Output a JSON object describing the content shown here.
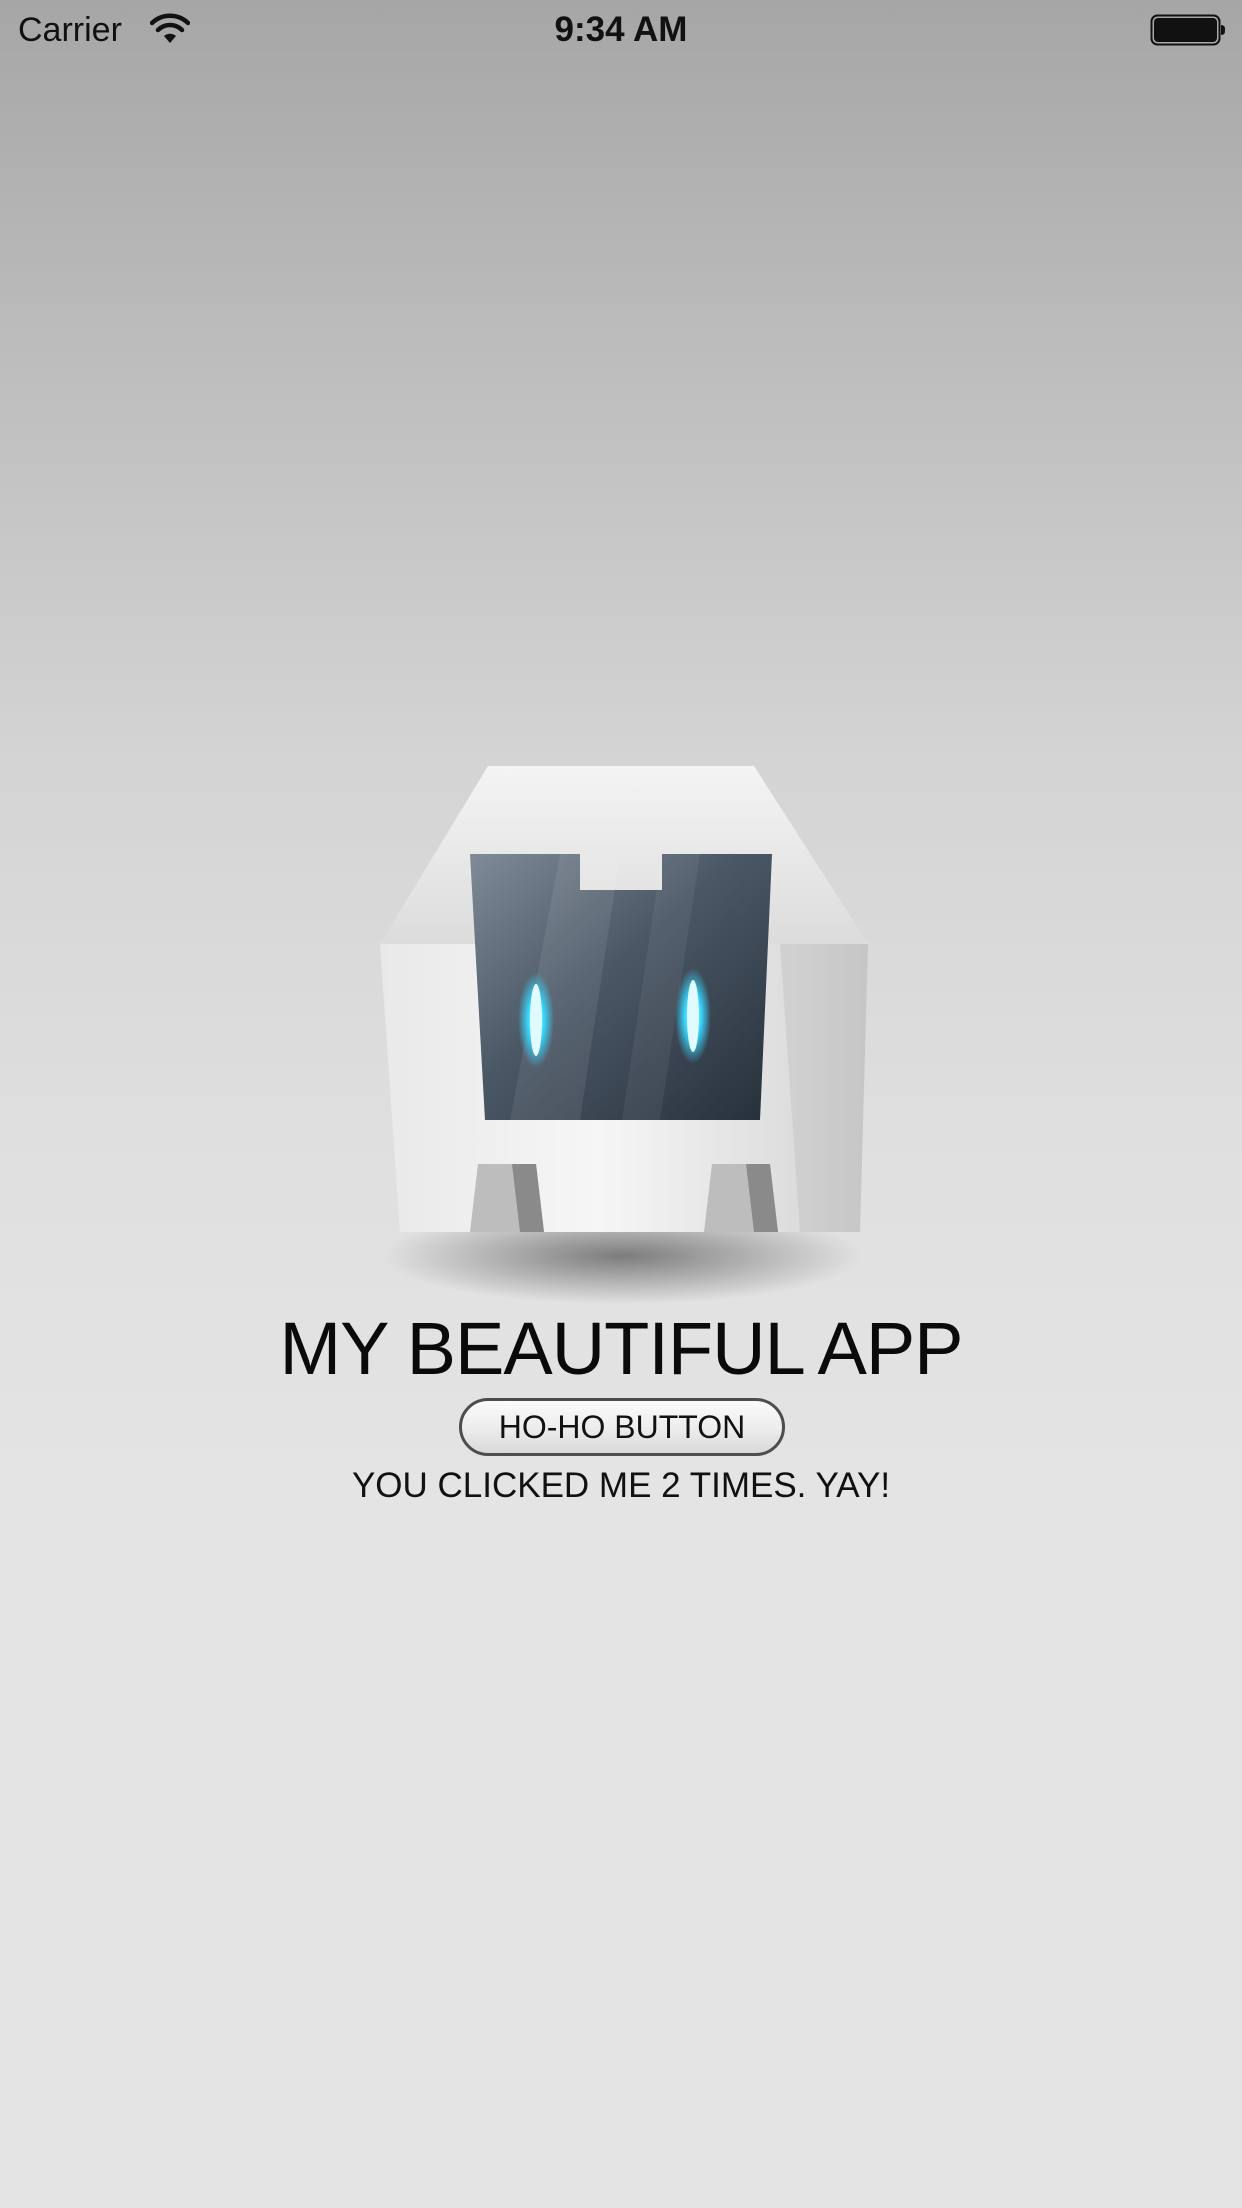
{
  "status_bar": {
    "carrier": "Carrier",
    "time": "9:34 AM",
    "wifi_icon": "wifi-icon",
    "battery_icon": "battery-full-icon"
  },
  "main": {
    "logo_icon": "cordova-robot-logo",
    "title": "MY BEAUTIFUL APP",
    "button_label": "HO-HO BUTTON",
    "click_status": "YOU CLICKED ME 2 TIMES. YAY!"
  },
  "colors": {
    "background_top": "#a6a6a6",
    "background_bottom": "#e4e4e4",
    "eye_glow": "#37d6ff",
    "visor": "#3a4754"
  }
}
